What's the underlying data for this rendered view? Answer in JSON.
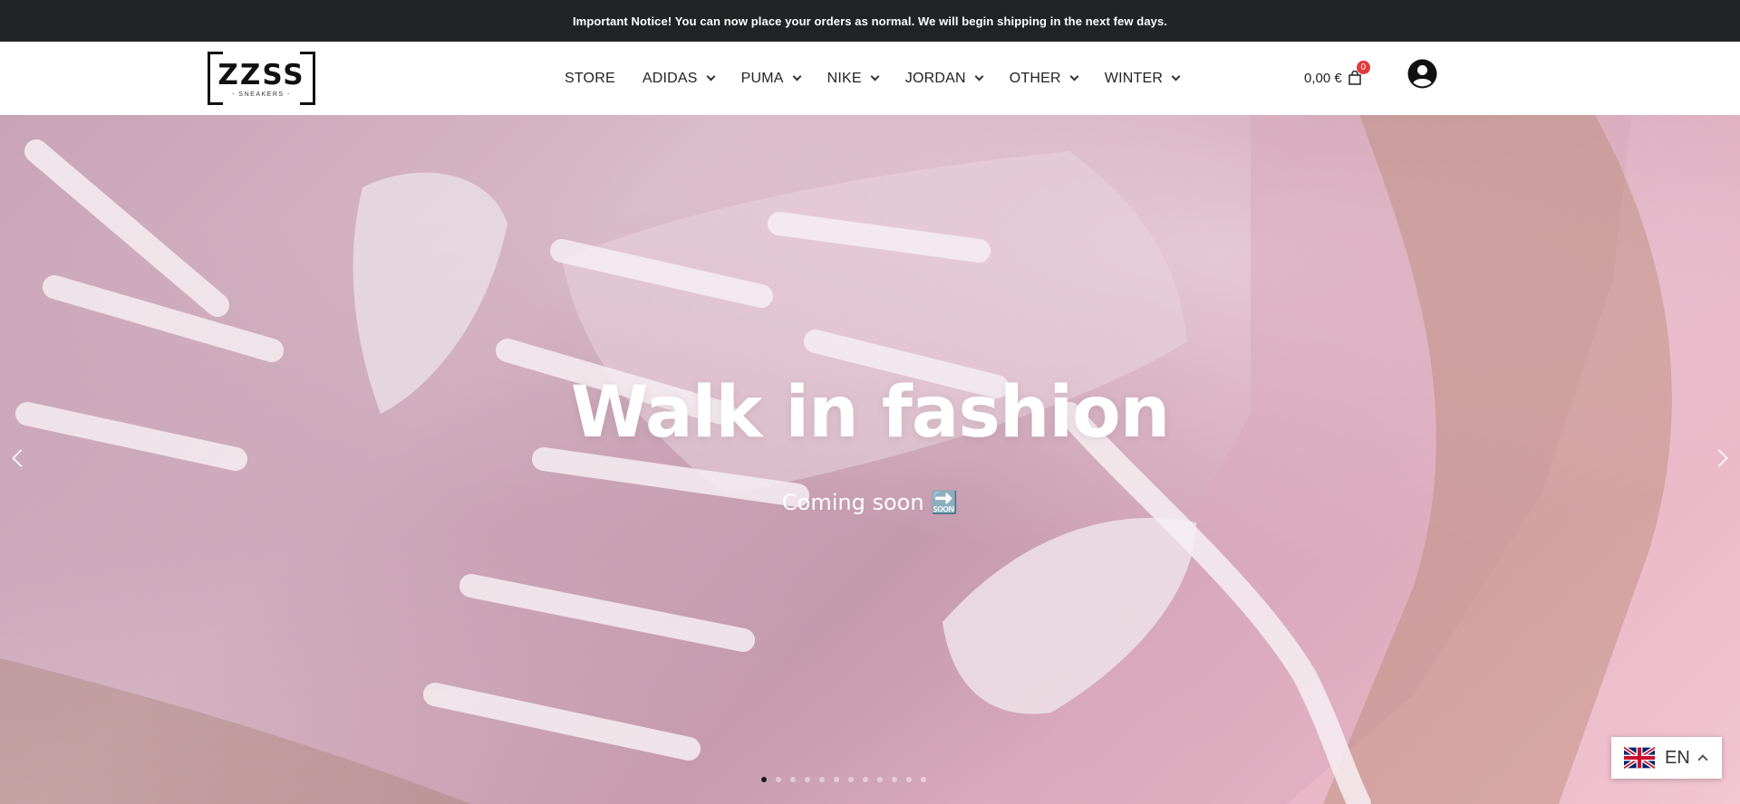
{
  "notice": {
    "text": "Important Notice! You can now place your orders as normal. We will begin shipping in the next few days."
  },
  "logo": {
    "main": "ZZSS",
    "sub": "- SNEAKERS -"
  },
  "nav": {
    "items": [
      {
        "label": "STORE",
        "has_dropdown": false
      },
      {
        "label": "ADIDAS",
        "has_dropdown": true
      },
      {
        "label": "PUMA",
        "has_dropdown": true
      },
      {
        "label": "NIKE",
        "has_dropdown": true
      },
      {
        "label": "JORDAN",
        "has_dropdown": true
      },
      {
        "label": "OTHER",
        "has_dropdown": true
      },
      {
        "label": "WINTER",
        "has_dropdown": true
      }
    ]
  },
  "cart": {
    "total": "0,00  €",
    "count": "0",
    "icon": "shopping-bag-icon"
  },
  "account": {
    "icon": "user-circle-icon"
  },
  "hero": {
    "title": "Walk in fashion",
    "subtitle": "Coming soon 🔜",
    "slide_count": 12,
    "active_slide": 1,
    "prev_icon": "chevron-left-icon",
    "next_icon": "chevron-right-icon"
  },
  "language": {
    "label": "EN",
    "flag": "uk-flag-icon"
  },
  "colors": {
    "notice_bg": "#222325",
    "badge": "#e23b3b"
  }
}
